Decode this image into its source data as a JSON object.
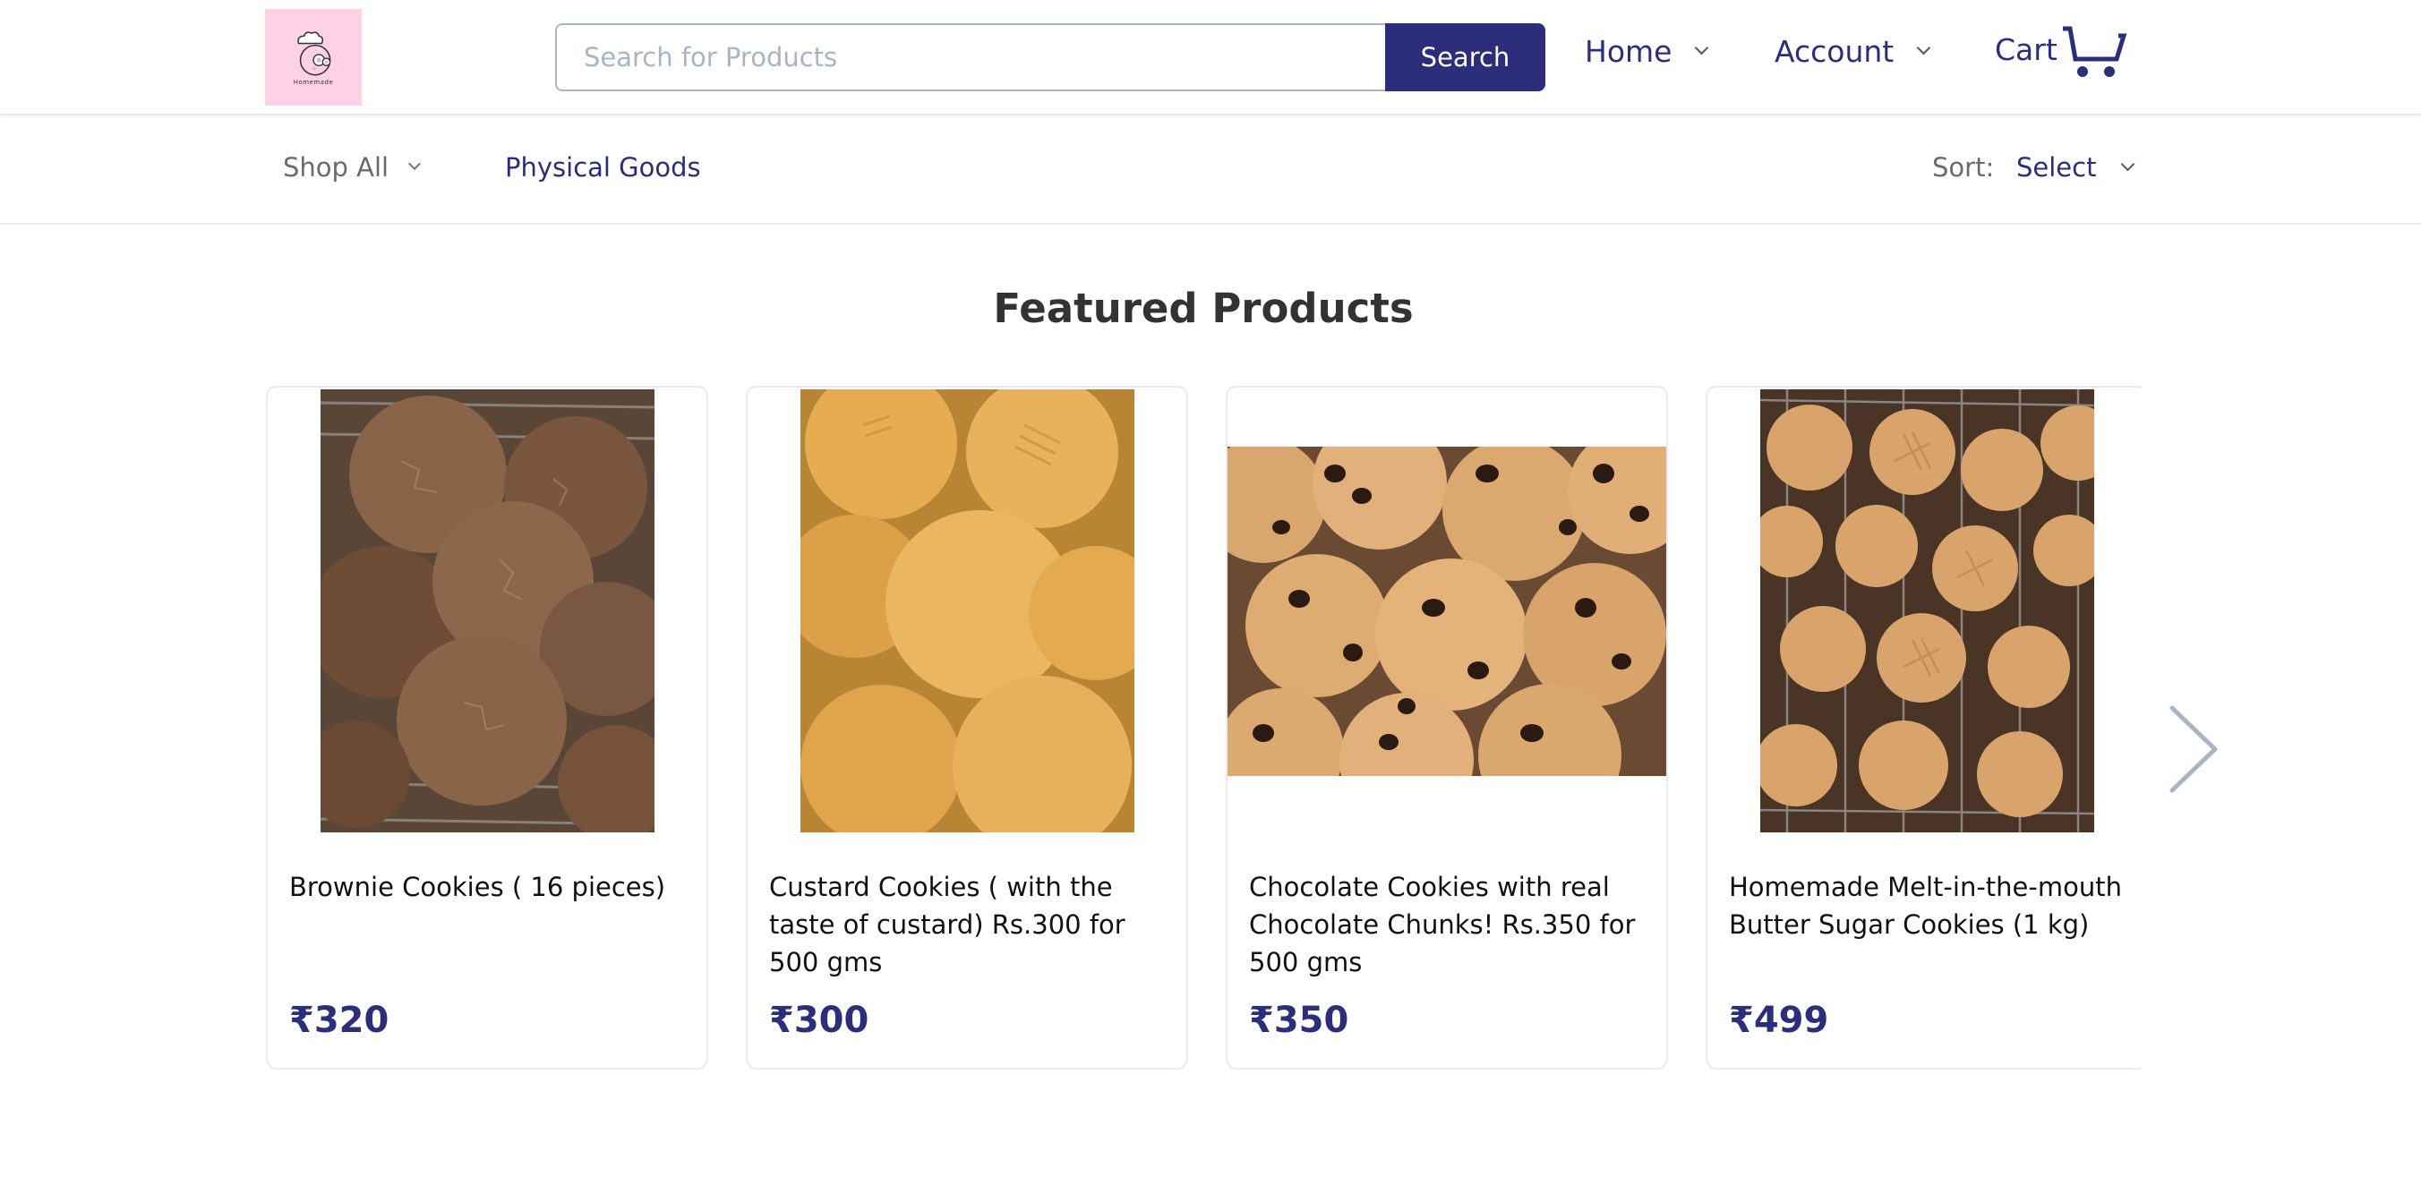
{
  "header": {
    "logo_alt": "Homemade",
    "search": {
      "placeholder": "Search for Products",
      "value": "",
      "button_label": "Search"
    },
    "nav": {
      "home_label": "Home",
      "account_label": "Account",
      "cart_label": "Cart"
    }
  },
  "subnav": {
    "shop_all_label": "Shop All",
    "physical_goods_label": "Physical Goods",
    "sort_label": "Sort:",
    "sort_selected": "Select"
  },
  "featured": {
    "title": "Featured Products",
    "products": [
      {
        "title": "Brownie Cookies ( 16 pieces)",
        "price": "₹320",
        "image": "brownie-cookies-photo"
      },
      {
        "title": "Custard Cookies ( with the taste of custard) Rs.300 for 500 gms",
        "price": "₹300",
        "image": "custard-cookies-photo"
      },
      {
        "title": "Chocolate Cookies with real Chocolate Chunks! Rs.350 for 500 gms",
        "price": "₹350",
        "image": "chocolate-chip-cookies-photo"
      },
      {
        "title": "Homemade Melt-in-the-mouth Butter Sugar Cookies (1 kg)",
        "price": "₹499",
        "image": "butter-sugar-cookies-photo"
      }
    ],
    "next_icon": "chevron-right-icon"
  },
  "colors": {
    "brand": "#2c2e7c",
    "logo_bg": "#ffd1e6",
    "muted_text": "#6b6b6b",
    "border": "#a9b4c4"
  }
}
